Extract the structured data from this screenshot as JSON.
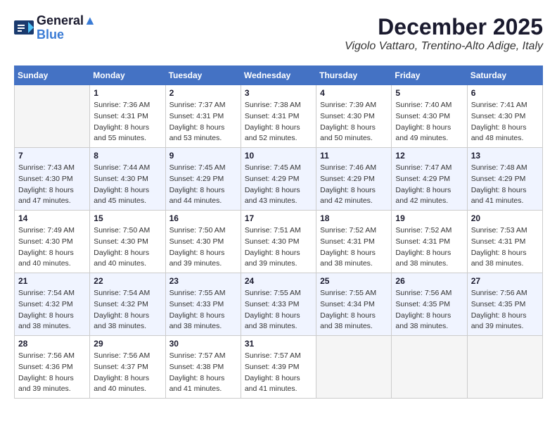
{
  "header": {
    "logo_line1": "General",
    "logo_line2": "Blue",
    "month_title": "December 2025",
    "location": "Vigolo Vattaro, Trentino-Alto Adige, Italy"
  },
  "weekdays": [
    "Sunday",
    "Monday",
    "Tuesday",
    "Wednesday",
    "Thursday",
    "Friday",
    "Saturday"
  ],
  "weeks": [
    [
      {
        "day": "",
        "sunrise": "",
        "sunset": "",
        "daylight": ""
      },
      {
        "day": "1",
        "sunrise": "Sunrise: 7:36 AM",
        "sunset": "Sunset: 4:31 PM",
        "daylight": "Daylight: 8 hours and 55 minutes."
      },
      {
        "day": "2",
        "sunrise": "Sunrise: 7:37 AM",
        "sunset": "Sunset: 4:31 PM",
        "daylight": "Daylight: 8 hours and 53 minutes."
      },
      {
        "day": "3",
        "sunrise": "Sunrise: 7:38 AM",
        "sunset": "Sunset: 4:31 PM",
        "daylight": "Daylight: 8 hours and 52 minutes."
      },
      {
        "day": "4",
        "sunrise": "Sunrise: 7:39 AM",
        "sunset": "Sunset: 4:30 PM",
        "daylight": "Daylight: 8 hours and 50 minutes."
      },
      {
        "day": "5",
        "sunrise": "Sunrise: 7:40 AM",
        "sunset": "Sunset: 4:30 PM",
        "daylight": "Daylight: 8 hours and 49 minutes."
      },
      {
        "day": "6",
        "sunrise": "Sunrise: 7:41 AM",
        "sunset": "Sunset: 4:30 PM",
        "daylight": "Daylight: 8 hours and 48 minutes."
      }
    ],
    [
      {
        "day": "7",
        "sunrise": "Sunrise: 7:43 AM",
        "sunset": "Sunset: 4:30 PM",
        "daylight": "Daylight: 8 hours and 47 minutes."
      },
      {
        "day": "8",
        "sunrise": "Sunrise: 7:44 AM",
        "sunset": "Sunset: 4:30 PM",
        "daylight": "Daylight: 8 hours and 45 minutes."
      },
      {
        "day": "9",
        "sunrise": "Sunrise: 7:45 AM",
        "sunset": "Sunset: 4:29 PM",
        "daylight": "Daylight: 8 hours and 44 minutes."
      },
      {
        "day": "10",
        "sunrise": "Sunrise: 7:45 AM",
        "sunset": "Sunset: 4:29 PM",
        "daylight": "Daylight: 8 hours and 43 minutes."
      },
      {
        "day": "11",
        "sunrise": "Sunrise: 7:46 AM",
        "sunset": "Sunset: 4:29 PM",
        "daylight": "Daylight: 8 hours and 42 minutes."
      },
      {
        "day": "12",
        "sunrise": "Sunrise: 7:47 AM",
        "sunset": "Sunset: 4:29 PM",
        "daylight": "Daylight: 8 hours and 42 minutes."
      },
      {
        "day": "13",
        "sunrise": "Sunrise: 7:48 AM",
        "sunset": "Sunset: 4:29 PM",
        "daylight": "Daylight: 8 hours and 41 minutes."
      }
    ],
    [
      {
        "day": "14",
        "sunrise": "Sunrise: 7:49 AM",
        "sunset": "Sunset: 4:30 PM",
        "daylight": "Daylight: 8 hours and 40 minutes."
      },
      {
        "day": "15",
        "sunrise": "Sunrise: 7:50 AM",
        "sunset": "Sunset: 4:30 PM",
        "daylight": "Daylight: 8 hours and 40 minutes."
      },
      {
        "day": "16",
        "sunrise": "Sunrise: 7:50 AM",
        "sunset": "Sunset: 4:30 PM",
        "daylight": "Daylight: 8 hours and 39 minutes."
      },
      {
        "day": "17",
        "sunrise": "Sunrise: 7:51 AM",
        "sunset": "Sunset: 4:30 PM",
        "daylight": "Daylight: 8 hours and 39 minutes."
      },
      {
        "day": "18",
        "sunrise": "Sunrise: 7:52 AM",
        "sunset": "Sunset: 4:31 PM",
        "daylight": "Daylight: 8 hours and 38 minutes."
      },
      {
        "day": "19",
        "sunrise": "Sunrise: 7:52 AM",
        "sunset": "Sunset: 4:31 PM",
        "daylight": "Daylight: 8 hours and 38 minutes."
      },
      {
        "day": "20",
        "sunrise": "Sunrise: 7:53 AM",
        "sunset": "Sunset: 4:31 PM",
        "daylight": "Daylight: 8 hours and 38 minutes."
      }
    ],
    [
      {
        "day": "21",
        "sunrise": "Sunrise: 7:54 AM",
        "sunset": "Sunset: 4:32 PM",
        "daylight": "Daylight: 8 hours and 38 minutes."
      },
      {
        "day": "22",
        "sunrise": "Sunrise: 7:54 AM",
        "sunset": "Sunset: 4:32 PM",
        "daylight": "Daylight: 8 hours and 38 minutes."
      },
      {
        "day": "23",
        "sunrise": "Sunrise: 7:55 AM",
        "sunset": "Sunset: 4:33 PM",
        "daylight": "Daylight: 8 hours and 38 minutes."
      },
      {
        "day": "24",
        "sunrise": "Sunrise: 7:55 AM",
        "sunset": "Sunset: 4:33 PM",
        "daylight": "Daylight: 8 hours and 38 minutes."
      },
      {
        "day": "25",
        "sunrise": "Sunrise: 7:55 AM",
        "sunset": "Sunset: 4:34 PM",
        "daylight": "Daylight: 8 hours and 38 minutes."
      },
      {
        "day": "26",
        "sunrise": "Sunrise: 7:56 AM",
        "sunset": "Sunset: 4:35 PM",
        "daylight": "Daylight: 8 hours and 38 minutes."
      },
      {
        "day": "27",
        "sunrise": "Sunrise: 7:56 AM",
        "sunset": "Sunset: 4:35 PM",
        "daylight": "Daylight: 8 hours and 39 minutes."
      }
    ],
    [
      {
        "day": "28",
        "sunrise": "Sunrise: 7:56 AM",
        "sunset": "Sunset: 4:36 PM",
        "daylight": "Daylight: 8 hours and 39 minutes."
      },
      {
        "day": "29",
        "sunrise": "Sunrise: 7:56 AM",
        "sunset": "Sunset: 4:37 PM",
        "daylight": "Daylight: 8 hours and 40 minutes."
      },
      {
        "day": "30",
        "sunrise": "Sunrise: 7:57 AM",
        "sunset": "Sunset: 4:38 PM",
        "daylight": "Daylight: 8 hours and 41 minutes."
      },
      {
        "day": "31",
        "sunrise": "Sunrise: 7:57 AM",
        "sunset": "Sunset: 4:39 PM",
        "daylight": "Daylight: 8 hours and 41 minutes."
      },
      {
        "day": "",
        "sunrise": "",
        "sunset": "",
        "daylight": ""
      },
      {
        "day": "",
        "sunrise": "",
        "sunset": "",
        "daylight": ""
      },
      {
        "day": "",
        "sunrise": "",
        "sunset": "",
        "daylight": ""
      }
    ]
  ]
}
